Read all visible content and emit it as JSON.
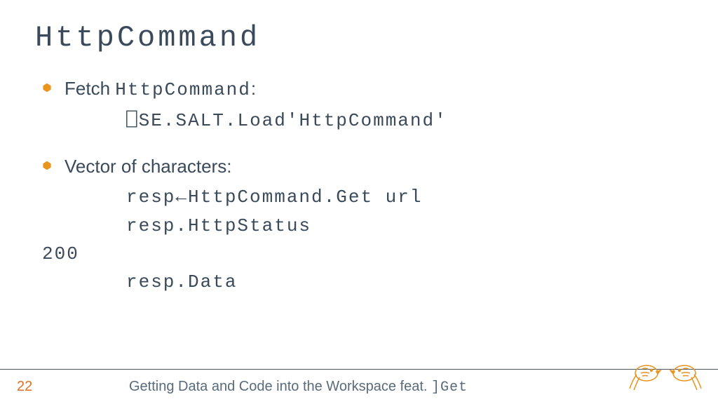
{
  "title": "HttpCommand",
  "bullets": [
    {
      "label_prefix": "Fetch ",
      "label_mono": "HttpCommand",
      "label_suffix": ":",
      "code_lines": [
        "⎕SE.SALT.Load'HttpCommand'"
      ],
      "output_lines": []
    },
    {
      "label_prefix": "Vector of characters:",
      "label_mono": "",
      "label_suffix": "",
      "code_lines": [
        "resp←HttpCommand.Get url",
        "resp.HttpStatus"
      ],
      "output_lines": [
        "200"
      ],
      "trailing_code_lines": [
        "resp.Data"
      ]
    }
  ],
  "footer": {
    "page": "22",
    "text_prefix": "Getting Data and Code into the Workspace feat. ",
    "text_mono": "]Get"
  },
  "colors": {
    "accent": "#e07020",
    "text": "#3a4a5a"
  }
}
